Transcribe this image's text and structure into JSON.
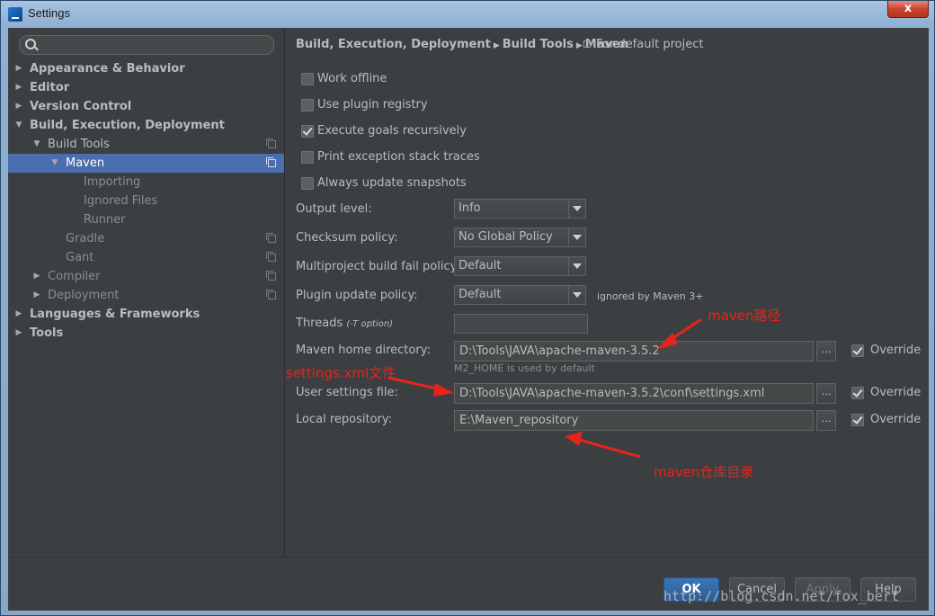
{
  "window": {
    "title": "Settings",
    "close_label": "x"
  },
  "search": {
    "placeholder": ""
  },
  "tree": [
    {
      "label": "Appearance & Behavior",
      "arrow": "▶",
      "bold": true,
      "dim": false,
      "selected": false,
      "copy": false,
      "indent": 0
    },
    {
      "label": "Editor",
      "arrow": "▶",
      "bold": true,
      "dim": false,
      "selected": false,
      "copy": false,
      "indent": 0
    },
    {
      "label": "Version Control",
      "arrow": "▶",
      "bold": true,
      "dim": false,
      "selected": false,
      "copy": false,
      "indent": 0
    },
    {
      "label": "Build, Execution, Deployment",
      "arrow": "▼",
      "bold": true,
      "dim": false,
      "selected": false,
      "copy": false,
      "indent": 0
    },
    {
      "label": "Build Tools",
      "arrow": "▼",
      "bold": false,
      "dim": false,
      "selected": false,
      "copy": true,
      "indent": 1
    },
    {
      "label": "Maven",
      "arrow": "▼",
      "bold": false,
      "dim": false,
      "selected": true,
      "copy": true,
      "indent": 2
    },
    {
      "label": "Importing",
      "arrow": "",
      "bold": false,
      "dim": true,
      "selected": false,
      "copy": false,
      "indent": 3
    },
    {
      "label": "Ignored Files",
      "arrow": "",
      "bold": false,
      "dim": true,
      "selected": false,
      "copy": false,
      "indent": 3
    },
    {
      "label": "Runner",
      "arrow": "",
      "bold": false,
      "dim": true,
      "selected": false,
      "copy": false,
      "indent": 3
    },
    {
      "label": "Gradle",
      "arrow": "",
      "bold": false,
      "dim": true,
      "selected": false,
      "copy": true,
      "indent": 2
    },
    {
      "label": "Gant",
      "arrow": "",
      "bold": false,
      "dim": true,
      "selected": false,
      "copy": true,
      "indent": 2
    },
    {
      "label": "Compiler",
      "arrow": "▶",
      "bold": false,
      "dim": true,
      "selected": false,
      "copy": true,
      "indent": 1
    },
    {
      "label": "Deployment",
      "arrow": "▶",
      "bold": false,
      "dim": true,
      "selected": false,
      "copy": true,
      "indent": 1
    },
    {
      "label": "Languages & Frameworks",
      "arrow": "▶",
      "bold": true,
      "dim": false,
      "selected": false,
      "copy": false,
      "indent": 0
    },
    {
      "label": "Tools",
      "arrow": "▶",
      "bold": true,
      "dim": false,
      "selected": false,
      "copy": false,
      "indent": 0
    }
  ],
  "breadcrumb": {
    "part1": "Build, Execution, Deployment",
    "part2": "Build Tools",
    "part3": "Maven",
    "sep": "▶",
    "scope": "For default project"
  },
  "checkboxes": [
    {
      "label": "Work offline",
      "checked": false
    },
    {
      "label": "Use plugin registry",
      "checked": false
    },
    {
      "label": "Execute goals recursively",
      "checked": true
    },
    {
      "label": "Print exception stack traces",
      "checked": false
    },
    {
      "label": "Always update snapshots",
      "checked": false
    }
  ],
  "fields": {
    "output_level": {
      "label": "Output level:",
      "value": "Info"
    },
    "checksum_policy": {
      "label": "Checksum policy:",
      "value": "No Global Policy"
    },
    "multiproject_fail_policy": {
      "label": "Multiproject build fail policy:",
      "value": "Default"
    },
    "plugin_update_policy": {
      "label": "Plugin update policy:",
      "value": "Default",
      "note": "ignored by Maven 3+"
    },
    "threads": {
      "label": "Threads",
      "hint": "(-T option)",
      "value": ""
    },
    "maven_home": {
      "label": "Maven home directory:",
      "value": "D:\\Tools\\JAVA\\apache-maven-3.5.2",
      "note": "M2_HOME is used by default",
      "override": true
    },
    "user_settings": {
      "label": "User settings file:",
      "value": "D:\\Tools\\JAVA\\apache-maven-3.5.2\\conf\\settings.xml",
      "override": true
    },
    "local_repo": {
      "label": "Local repository:",
      "value": "E:\\Maven_repository",
      "override": true
    }
  },
  "browse_label": "...",
  "override_label": "Override",
  "buttons": {
    "ok": "OK",
    "cancel": "Cancel",
    "apply": "Apply",
    "help": "Help"
  },
  "annotations": {
    "maven_path": "maven路径",
    "settings_file": "settings.xml文件",
    "repo_dir": "maven仓库目录",
    "color": "#e8231a"
  },
  "watermark": "http://blog.csdn.net/fox_bert"
}
